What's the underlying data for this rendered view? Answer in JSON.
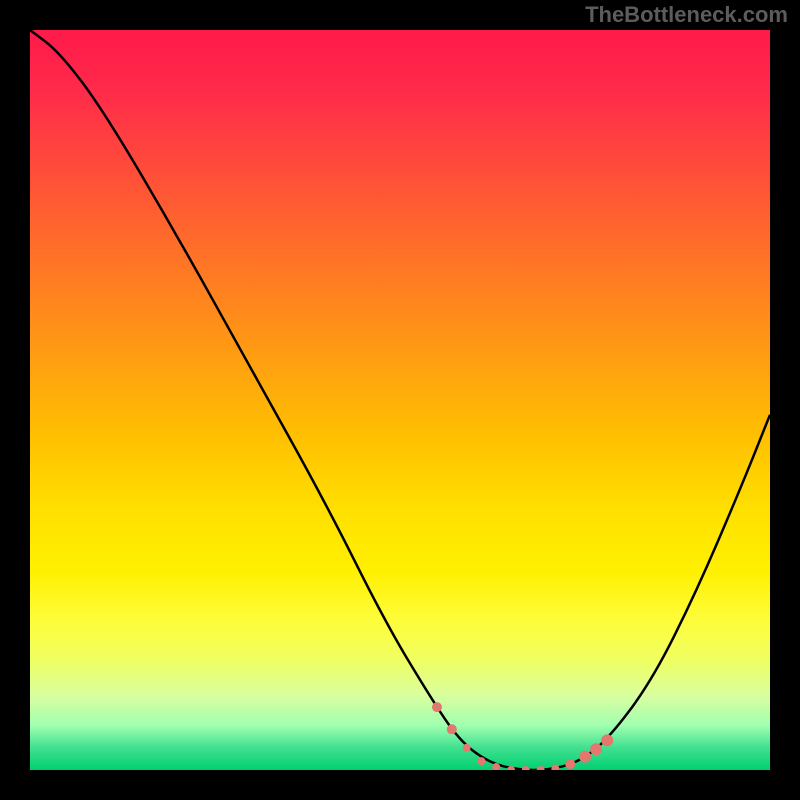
{
  "watermark": "TheBottleneck.com",
  "chart_data": {
    "type": "line",
    "title": "",
    "xlabel": "",
    "ylabel": "",
    "xlim": [
      0,
      100
    ],
    "ylim": [
      0,
      100
    ],
    "curve": [
      {
        "x": 0,
        "y": 100
      },
      {
        "x": 4,
        "y": 97
      },
      {
        "x": 10,
        "y": 89
      },
      {
        "x": 20,
        "y": 72
      },
      {
        "x": 30,
        "y": 54
      },
      {
        "x": 40,
        "y": 36
      },
      {
        "x": 48,
        "y": 20
      },
      {
        "x": 54,
        "y": 10
      },
      {
        "x": 58,
        "y": 4
      },
      {
        "x": 62,
        "y": 1
      },
      {
        "x": 66,
        "y": 0
      },
      {
        "x": 70,
        "y": 0
      },
      {
        "x": 74,
        "y": 1
      },
      {
        "x": 78,
        "y": 4
      },
      {
        "x": 84,
        "y": 12
      },
      {
        "x": 90,
        "y": 24
      },
      {
        "x": 96,
        "y": 38
      },
      {
        "x": 100,
        "y": 48
      }
    ],
    "markers": [
      {
        "x": 55,
        "y": 8.5,
        "r": 5
      },
      {
        "x": 57,
        "y": 5.5,
        "r": 5
      },
      {
        "x": 59,
        "y": 3,
        "r": 4
      },
      {
        "x": 61,
        "y": 1.2,
        "r": 4
      },
      {
        "x": 63,
        "y": 0.4,
        "r": 4
      },
      {
        "x": 65,
        "y": 0,
        "r": 4
      },
      {
        "x": 67,
        "y": 0,
        "r": 4
      },
      {
        "x": 69,
        "y": 0,
        "r": 4
      },
      {
        "x": 71,
        "y": 0.2,
        "r": 4
      },
      {
        "x": 73,
        "y": 0.8,
        "r": 5
      },
      {
        "x": 75,
        "y": 1.8,
        "r": 6
      },
      {
        "x": 76.5,
        "y": 2.8,
        "r": 6
      },
      {
        "x": 78,
        "y": 4.0,
        "r": 6
      }
    ],
    "marker_color": "#e2786e",
    "curve_color": "#000000"
  }
}
